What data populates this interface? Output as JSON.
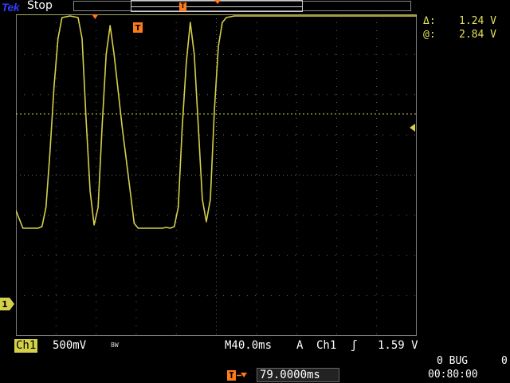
{
  "header": {
    "brand": "Tek",
    "run_state": "Stop",
    "record_trigger_glyph": "T"
  },
  "cursor_readout": {
    "delta_label": "Δ:",
    "delta_value": "1.24 V",
    "at_label": "@:",
    "at_value": "2.84 V"
  },
  "graticule": {
    "trigger_marker_glyph": "T",
    "ch1_marker_glyph": "1"
  },
  "status_bar": {
    "channel": "Ch1",
    "vertical_scale": "500mV",
    "bandwidth_icon": "BW",
    "timebase": "M40.0ms",
    "trigger_mode": "A",
    "trigger_source": "Ch1",
    "trigger_slope_icon": "rising-edge-icon",
    "trigger_slope_glyph": "ʃ",
    "trigger_level": "1.59 V"
  },
  "trigger_position": {
    "value": "79.0000ms"
  },
  "system": {
    "counter_label": "0 BUG",
    "counter_right": "0",
    "clock": "00:80:00"
  },
  "colors": {
    "trace": "#d4d04a",
    "grid": "#6a6a6a",
    "trigger_accent": "#ff7a1a",
    "brand": "#2f3cff"
  },
  "chart_data": {
    "type": "line",
    "title": "",
    "xlabel": "",
    "ylabel": "",
    "x_unit": "ms",
    "y_unit": "V",
    "xlim": [
      -79,
      321
    ],
    "ylim": [
      -1.0,
      3.0
    ],
    "grid": true,
    "cursors": [
      {
        "kind": "horizontal",
        "y": 3.0
      },
      {
        "kind": "horizontal",
        "y": 1.76
      }
    ],
    "trigger_level_v": 1.59,
    "series": [
      {
        "channel": "Ch1",
        "x": [
          -79,
          -72,
          -66,
          -62,
          -57,
          -53,
          -49,
          -45,
          -41,
          -37,
          -33,
          -25,
          -17,
          -13,
          -9,
          -5,
          -1,
          3,
          7,
          11,
          15,
          19,
          27,
          35,
          39,
          43,
          47,
          51,
          55,
          59,
          63,
          67,
          71,
          75,
          79,
          83,
          87,
          91,
          95,
          99,
          103,
          107,
          111,
          115,
          119,
          123,
          127,
          131,
          135,
          139,
          143,
          147,
          151,
          155,
          159,
          163,
          167,
          171,
          175,
          179,
          183,
          187,
          191,
          195,
          199,
          203,
          207,
          211,
          215,
          219,
          223,
          227,
          231,
          235,
          239,
          243,
          247,
          251,
          255,
          259,
          263,
          267,
          271,
          275,
          279,
          283,
          287,
          291,
          295,
          299,
          303,
          307,
          311,
          315,
          319,
          321
        ],
        "y": [
          0.56,
          0.34,
          0.34,
          0.34,
          0.34,
          0.36,
          0.6,
          1.3,
          2.1,
          2.7,
          2.96,
          2.98,
          2.96,
          2.7,
          1.7,
          0.8,
          0.38,
          0.6,
          1.6,
          2.5,
          2.86,
          2.5,
          1.6,
          0.8,
          0.4,
          0.34,
          0.34,
          0.34,
          0.34,
          0.34,
          0.34,
          0.34,
          0.35,
          0.34,
          0.36,
          0.6,
          1.6,
          2.4,
          2.9,
          2.5,
          1.6,
          0.7,
          0.42,
          0.7,
          1.8,
          2.6,
          2.9,
          2.96,
          2.97,
          2.98,
          2.98,
          2.98,
          2.98,
          2.98,
          2.98,
          2.98,
          2.98,
          2.98,
          2.98,
          2.98,
          2.98,
          2.98,
          2.98,
          2.98,
          2.98,
          2.98,
          2.98,
          2.98,
          2.98,
          2.98,
          2.98,
          2.98,
          2.98,
          2.98,
          2.98,
          2.98,
          2.98,
          2.98,
          2.98,
          2.98,
          2.98,
          2.98,
          2.98,
          2.98,
          2.98,
          2.98,
          2.98,
          2.98,
          2.98,
          2.98,
          2.98,
          2.98,
          2.98,
          2.98,
          2.98,
          2.98
        ]
      }
    ]
  }
}
